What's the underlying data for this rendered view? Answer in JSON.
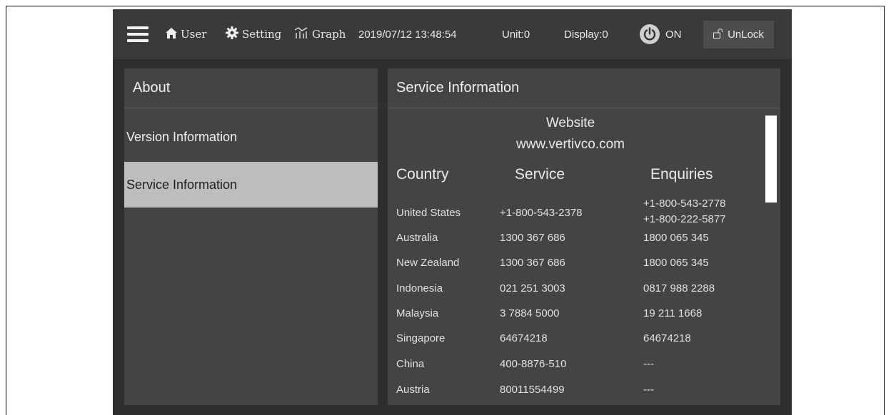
{
  "topbar": {
    "user_label": "User",
    "setting_label": "Setting",
    "graph_label": "Graph",
    "datetime": "2019/07/12 13:48:54",
    "unit": "Unit:0",
    "display": "Display:0",
    "power_status": "ON",
    "lock_label": "UnLock"
  },
  "left_panel": {
    "title": "About",
    "items": [
      {
        "label": "Version Information",
        "active": false
      },
      {
        "label": "Service Information",
        "active": true
      }
    ]
  },
  "right_panel": {
    "title": "Service Information",
    "website_label": "Website",
    "website_url": "www.vertivco.com",
    "headers": [
      "Country",
      "Service",
      "Enquiries"
    ],
    "rows": [
      {
        "country": "United States",
        "service": "+1-800-543-2378",
        "enquiries": [
          "+1-800-543-2778",
          "+1-800-222-5877"
        ]
      },
      {
        "country": "Australia",
        "service": "1300 367 686",
        "enquiries": [
          "1800 065 345"
        ]
      },
      {
        "country": "New Zealand",
        "service": "1300 367 686",
        "enquiries": [
          "1800 065 345"
        ]
      },
      {
        "country": "Indonesia",
        "service": "021 251 3003",
        "enquiries": [
          "0817 988 2288"
        ]
      },
      {
        "country": "Malaysia",
        "service": "3 7884 5000",
        "enquiries": [
          "19 211 1668"
        ]
      },
      {
        "country": "Singapore",
        "service": "64674218",
        "enquiries": [
          "64674218"
        ]
      },
      {
        "country": "China",
        "service": "400-8876-510",
        "enquiries": [
          "---"
        ]
      },
      {
        "country": "Austria",
        "service": "80011554499",
        "enquiries": [
          "---"
        ]
      }
    ]
  },
  "icons": {
    "menu": "hamburger-icon",
    "user": "home-icon",
    "setting": "gear-icon",
    "graph": "graph-icon",
    "power": "power-icon",
    "lock": "unlock-icon"
  },
  "colors": {
    "screen_bg": "#2e2e2e",
    "topbar_bg": "#3a3a3a",
    "panel_bg": "#444444",
    "active_item_bg": "#bdbdbd"
  }
}
